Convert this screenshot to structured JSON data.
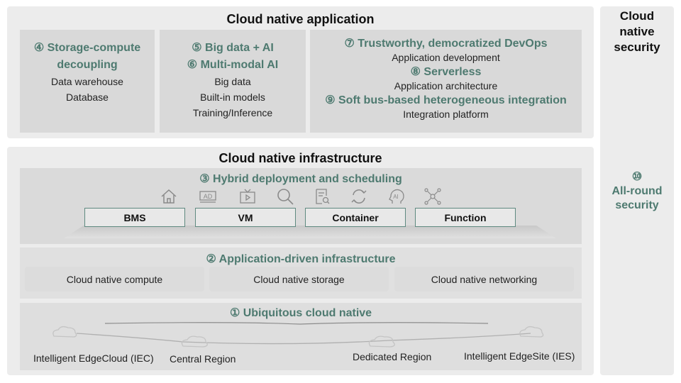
{
  "app": {
    "title": "Cloud native application",
    "columns": [
      {
        "headings": [
          "④ Storage-compute",
          "decoupling"
        ],
        "items": [
          "Data warehouse",
          "Database"
        ]
      },
      {
        "headings": [
          "⑤ Big data + AI",
          "⑥ Multi-modal AI"
        ],
        "items": [
          "Big data",
          "Built-in models",
          "Training/Inference"
        ]
      },
      {
        "entries": [
          {
            "heading": "⑦ Trustworthy, democratized DevOps",
            "item": "Application development"
          },
          {
            "heading": "⑧ Serverless",
            "item": "Application architecture"
          },
          {
            "heading": "⑨ Soft bus-based heterogeneous integration",
            "item": "Integration platform"
          }
        ]
      }
    ]
  },
  "infra": {
    "title": "Cloud native infrastructure",
    "hybrid": {
      "heading": "③ Hybrid deployment and scheduling",
      "icons": [
        "home-icon",
        "ad-icon",
        "video-icon",
        "search-icon",
        "document-search-icon",
        "refresh-icon",
        "ai-head-icon",
        "network-nodes-icon"
      ],
      "buttons": [
        "BMS",
        "VM",
        "Container",
        "Function"
      ]
    },
    "app_driven": {
      "heading": "② Application-driven infrastructure",
      "items": [
        "Cloud native compute",
        "Cloud native storage",
        "Cloud native networking"
      ]
    },
    "ubiquitous": {
      "heading": "① Ubiquitous cloud native",
      "regions": [
        "Intelligent EdgeCloud (IEC)",
        "Central Region",
        "Dedicated Region",
        "Intelligent EdgeSite (IES)"
      ]
    }
  },
  "security": {
    "title_lines": [
      "Cloud",
      "native",
      "security"
    ],
    "number": "⑩",
    "label_lines": [
      "All-round",
      "security"
    ]
  },
  "colors": {
    "accent": "#4e7a70",
    "panel": "#ececec",
    "box": "#d9d9d9"
  }
}
